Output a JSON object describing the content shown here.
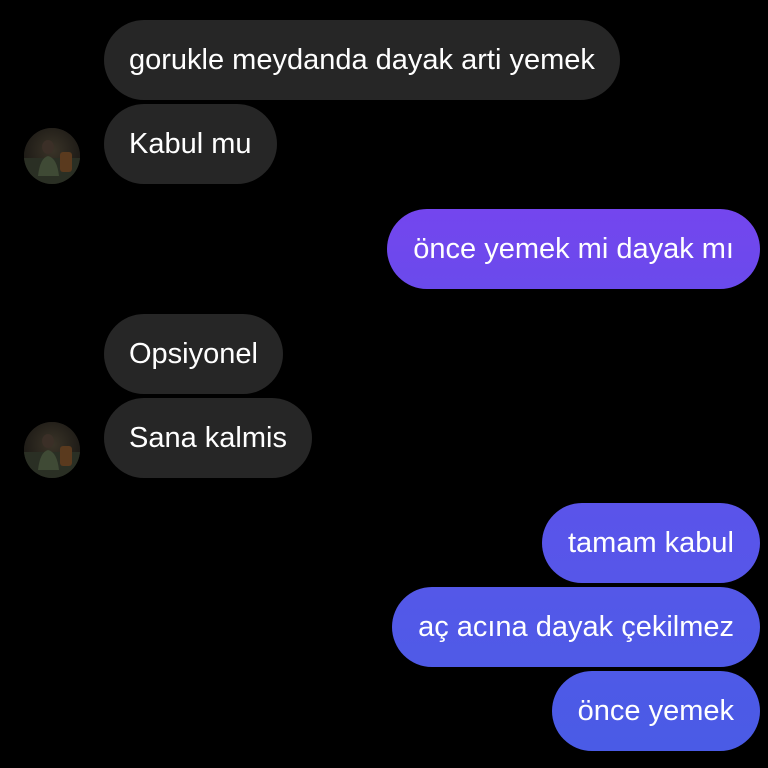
{
  "conversation": {
    "messages": [
      {
        "sender": "other",
        "text": "gorukle meydanda dayak arti yemek"
      },
      {
        "sender": "other",
        "text": "Kabul mu"
      },
      {
        "sender": "me",
        "text": "önce yemek mi dayak mı"
      },
      {
        "sender": "other",
        "text": "Opsiyonel"
      },
      {
        "sender": "other",
        "text": "Sana kalmis"
      },
      {
        "sender": "me",
        "text": "tamam kabul"
      },
      {
        "sender": "me",
        "text": "aç acına dayak çekilmez"
      },
      {
        "sender": "me",
        "text": "önce yemek"
      }
    ]
  },
  "colors": {
    "background": "#000000",
    "incoming_bubble": "#262626",
    "outgoing_gradient_top": "#7446ee",
    "outgoing_gradient_bottom": "#4a5be6",
    "text": "#ffffff"
  },
  "icons": {
    "contact_avatar": "contact-avatar-photo"
  }
}
